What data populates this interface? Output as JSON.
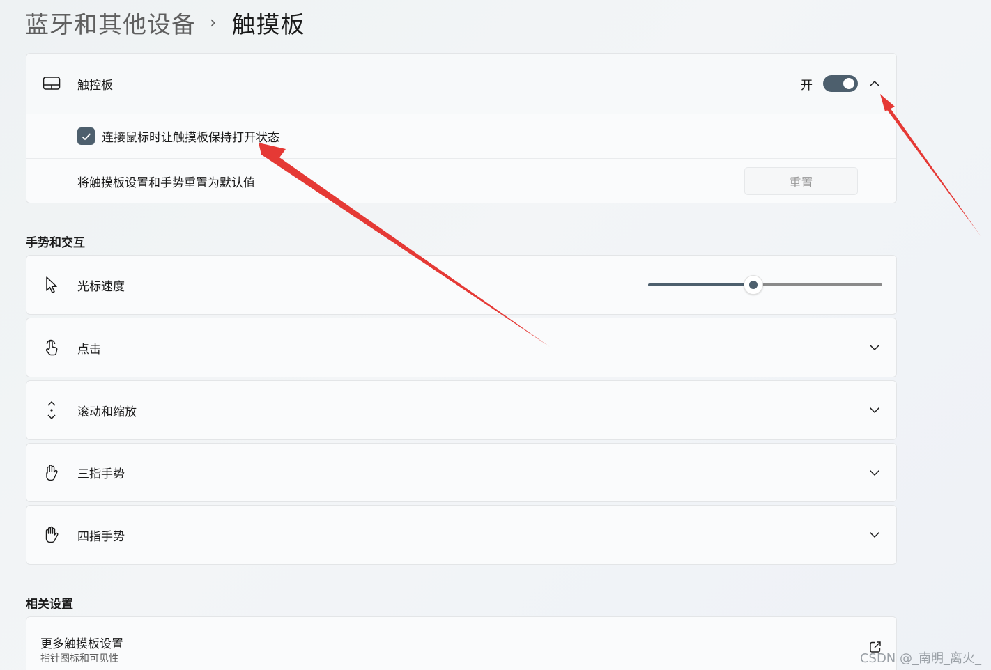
{
  "breadcrumb": {
    "parent": "蓝牙和其他设备",
    "separator": "›",
    "current": "触摸板"
  },
  "touchpad": {
    "label": "触控板",
    "toggle_state": "开",
    "toggle_on": true,
    "keep_on_label": "连接鼠标时让触摸板保持打开状态",
    "keep_on_checked": true,
    "reset_label": "将触摸板设置和手势重置为默认值",
    "reset_button": "重置"
  },
  "gestures": {
    "section_title": "手势和交互",
    "cursor_speed_label": "光标速度",
    "cursor_speed_value": 0.45,
    "items": [
      {
        "label": "点击",
        "icon": "tap-icon"
      },
      {
        "label": "滚动和缩放",
        "icon": "scroll-icon"
      },
      {
        "label": "三指手势",
        "icon": "hand-icon"
      },
      {
        "label": "四指手势",
        "icon": "hand-icon"
      }
    ]
  },
  "related": {
    "section_title": "相关设置",
    "title": "更多触摸板设置",
    "subtitle": "指针图标和可见性"
  },
  "watermark": "CSDN @_南明_离火_",
  "colors": {
    "accent": "#4d5f6d",
    "annotation_arrow": "#e53935"
  }
}
